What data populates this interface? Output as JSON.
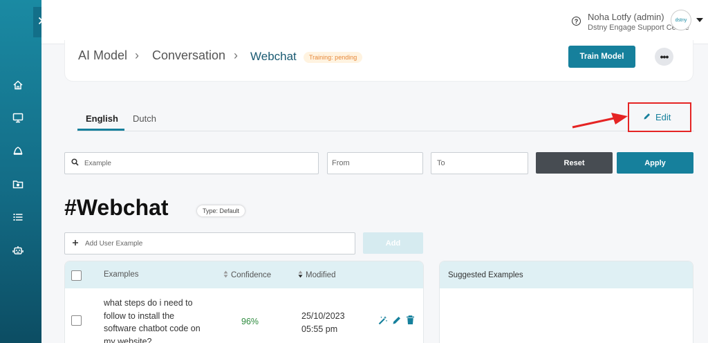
{
  "colors": {
    "accent": "#16809c",
    "sidebar": "#136c86",
    "confidence": "#2e8b3e",
    "training_badge": "#e6883a",
    "highlight": "#e52424"
  },
  "sidebar": {
    "toggle_icon": "chevron-right-icon",
    "items": [
      {
        "icon": "home-icon"
      },
      {
        "icon": "monitor-icon"
      },
      {
        "icon": "bell-icon"
      },
      {
        "icon": "folder-icon"
      },
      {
        "icon": "list-icon"
      },
      {
        "icon": "robot-icon"
      }
    ]
  },
  "header": {
    "help_icon": "?",
    "user_name": "Noha Lotfy (admin)",
    "org": "Dstny Engage Support Centre",
    "avatar_text": "dstny"
  },
  "breadcrumb": {
    "items": [
      "AI Model",
      "Conversation",
      "Webchat"
    ],
    "separator": "›",
    "training_status": "Training: pending"
  },
  "actions": {
    "train_model": "Train Model",
    "more": "•••"
  },
  "tabs": [
    "English",
    "Dutch"
  ],
  "edit": {
    "label": "Edit"
  },
  "filters": {
    "example_placeholder": "Example",
    "from_placeholder": "From",
    "to_placeholder": "To",
    "reset": "Reset",
    "apply": "Apply"
  },
  "intent": {
    "title": "#Webchat",
    "type": "Type: Default"
  },
  "add_example": {
    "placeholder": "Add User Example",
    "button": "Add"
  },
  "table": {
    "columns": [
      "Examples",
      "Confidence",
      "Modified"
    ],
    "rows": [
      {
        "example_lines": [
          "what steps do i need to",
          "follow to install the",
          "software chatbot code on",
          "my website?"
        ],
        "confidence": "96%",
        "modified_date": "25/10/2023",
        "modified_time": "05:55 pm"
      }
    ]
  },
  "suggested": {
    "title": "Suggested Examples"
  }
}
